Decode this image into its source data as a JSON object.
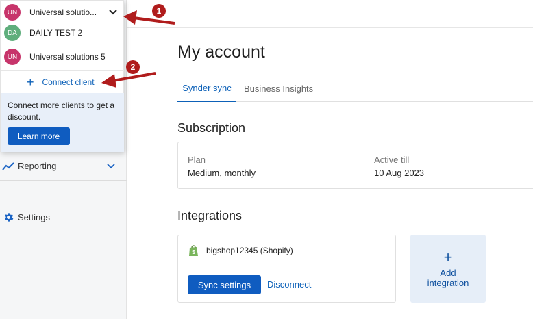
{
  "sidebar": {
    "items": [
      {
        "label": "Reporting",
        "icon": "chart-line-icon"
      },
      {
        "label": "Settings",
        "icon": "gear-icon"
      }
    ]
  },
  "dropdown": {
    "clients": [
      {
        "initials": "UN",
        "name": "Universal solutio...",
        "color": "#c7356b"
      },
      {
        "initials": "DA",
        "name": "DAILY TEST 2",
        "color": "#5fae7c"
      },
      {
        "initials": "UN",
        "name": "Universal solutions 5",
        "color": "#c7356b"
      }
    ],
    "connect_label": "Connect client",
    "promo_text": "Connect more clients to get a discount.",
    "learn_more": "Learn more"
  },
  "main": {
    "title": "My account",
    "tabs": [
      {
        "label": "Synder sync",
        "active": true
      },
      {
        "label": "Business Insights",
        "active": false
      }
    ],
    "subscription": {
      "heading": "Subscription",
      "plan_label": "Plan",
      "plan_value": "Medium, monthly",
      "active_label": "Active till",
      "active_value": "10 Aug 2023"
    },
    "integrations": {
      "heading": "Integrations",
      "shop_name": "bigshop12345 (Shopify)",
      "sync_settings": "Sync settings",
      "disconnect": "Disconnect",
      "add_label_line1": "Add",
      "add_label_line2": "integration"
    }
  },
  "annotations": {
    "badge1": "1",
    "badge2": "2",
    "color": "#b01c1c"
  },
  "colors": {
    "accent": "#0d61b8",
    "primary_button": "#0f5cc0"
  }
}
